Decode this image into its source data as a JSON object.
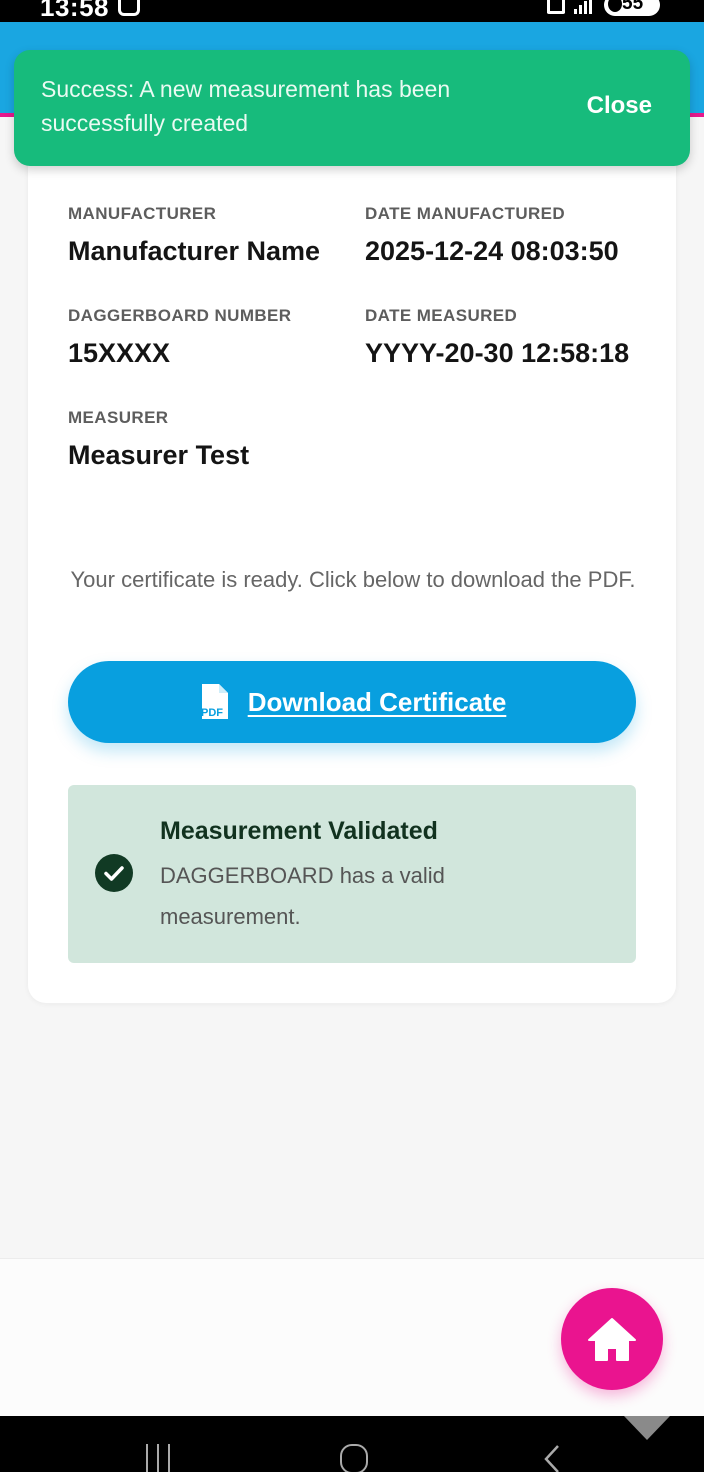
{
  "status_bar": {
    "time": "13:58",
    "battery": "55"
  },
  "toast": {
    "message": "Success: A new measurement has been successfully created",
    "close_label": "Close"
  },
  "details": {
    "manufacturer_label": "MANUFACTURER",
    "manufacturer_value": "Manufacturer Name",
    "date_manufactured_label": "DATE MANUFACTURED",
    "date_manufactured_value": "2025-12-24 08:03:50",
    "daggerboard_number_label": "DAGGERBOARD NUMBER",
    "daggerboard_number_value": "15XXXX",
    "date_measured_label": "DATE MEASURED",
    "date_measured_value": "YYYY-20-30 12:58:18",
    "measurer_label": "MEASURER",
    "measurer_value": "Measurer Test"
  },
  "certificate": {
    "ready_text": "Your certificate is ready. Click below to download the PDF.",
    "download_label": "Download Certificate",
    "pdf_icon_text": "PDF"
  },
  "validation": {
    "title": "Measurement Validated",
    "description": "DAGGERBOARD has a valid measurement."
  },
  "icons": {
    "pdf": "pdf-file-icon",
    "check": "check-circle-icon",
    "home": "home-icon"
  },
  "colors": {
    "header": "#1aa6e1",
    "toast": "#17bb7c",
    "primary_button": "#089fdf",
    "home_button": "#ea148f",
    "validated_box": "#d1e6dc"
  }
}
